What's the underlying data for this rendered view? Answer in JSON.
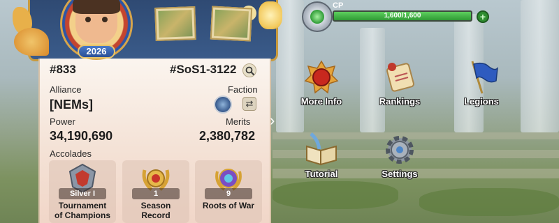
{
  "profile": {
    "avatar_year": "2026",
    "player_id": "#833",
    "server_tag": "#SoS1-3122",
    "alliance_label": "Alliance",
    "alliance_value": "[NEMs]",
    "faction_label": "Faction",
    "power_label": "Power",
    "power_value": "34,190,690",
    "merits_label": "Merits",
    "merits_value": "2,380,782",
    "accolades_label": "Accolades",
    "accolades": [
      {
        "count": "Silver I",
        "title_line1": "Tournament",
        "title_line2": "of Champions"
      },
      {
        "count": "1",
        "title_line1": "Season",
        "title_line2": "Record"
      },
      {
        "count": "9",
        "title_line1": "Roots of War",
        "title_line2": ""
      }
    ]
  },
  "cp": {
    "label": "CP",
    "value_text": "1,600/1,600",
    "fill_fraction": 1.0,
    "add_symbol": "+"
  },
  "menu": {
    "more_info": "More Info",
    "rankings": "Rankings",
    "legions": "Legions",
    "tutorial": "Tutorial",
    "settings": "Settings"
  },
  "icons": {
    "search": "search-icon",
    "swap": "swap-icon",
    "faction": "faction-emblem-icon",
    "cp_gem": "cp-gem-icon",
    "add": "add-icon"
  },
  "colors": {
    "cp_fill": "#2f9a34",
    "card_bg": "#f4e2d6",
    "banner_bg": "#2f4a73"
  }
}
